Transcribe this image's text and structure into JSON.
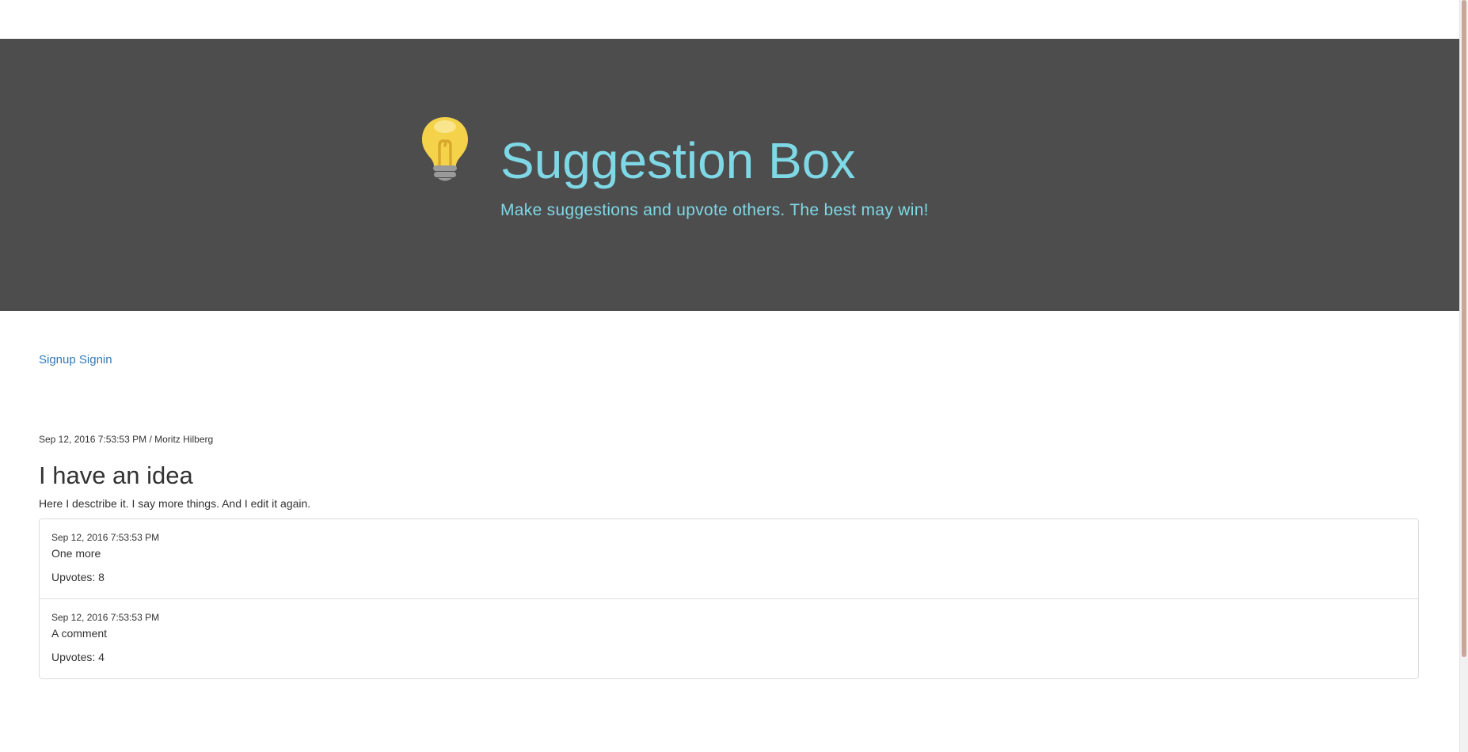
{
  "header": {
    "title": "Suggestion Box",
    "subtitle": "Make suggestions and upvote others. The best may win!",
    "logo_icon": "lightbulb-icon",
    "background_color": "#4d4d4d",
    "accent_color": "#7fd8e6"
  },
  "auth": {
    "signup_label": "Signup",
    "signin_label": "Signin",
    "link_color": "#337ab7"
  },
  "post": {
    "date": "Sep 12, 2016 7:53:53 PM",
    "separator": "/",
    "author": "Moritz Hilberg",
    "title": "I have an idea",
    "body": "Here I desctribe it. I say more things. And I edit it again."
  },
  "comments": [
    {
      "date": "Sep 12, 2016 7:53:53 PM",
      "text": "One more",
      "upvotes_label": "Upvotes: 8"
    },
    {
      "date": "Sep 12, 2016 7:53:53 PM",
      "text": "A comment",
      "upvotes_label": "Upvotes: 4"
    }
  ]
}
